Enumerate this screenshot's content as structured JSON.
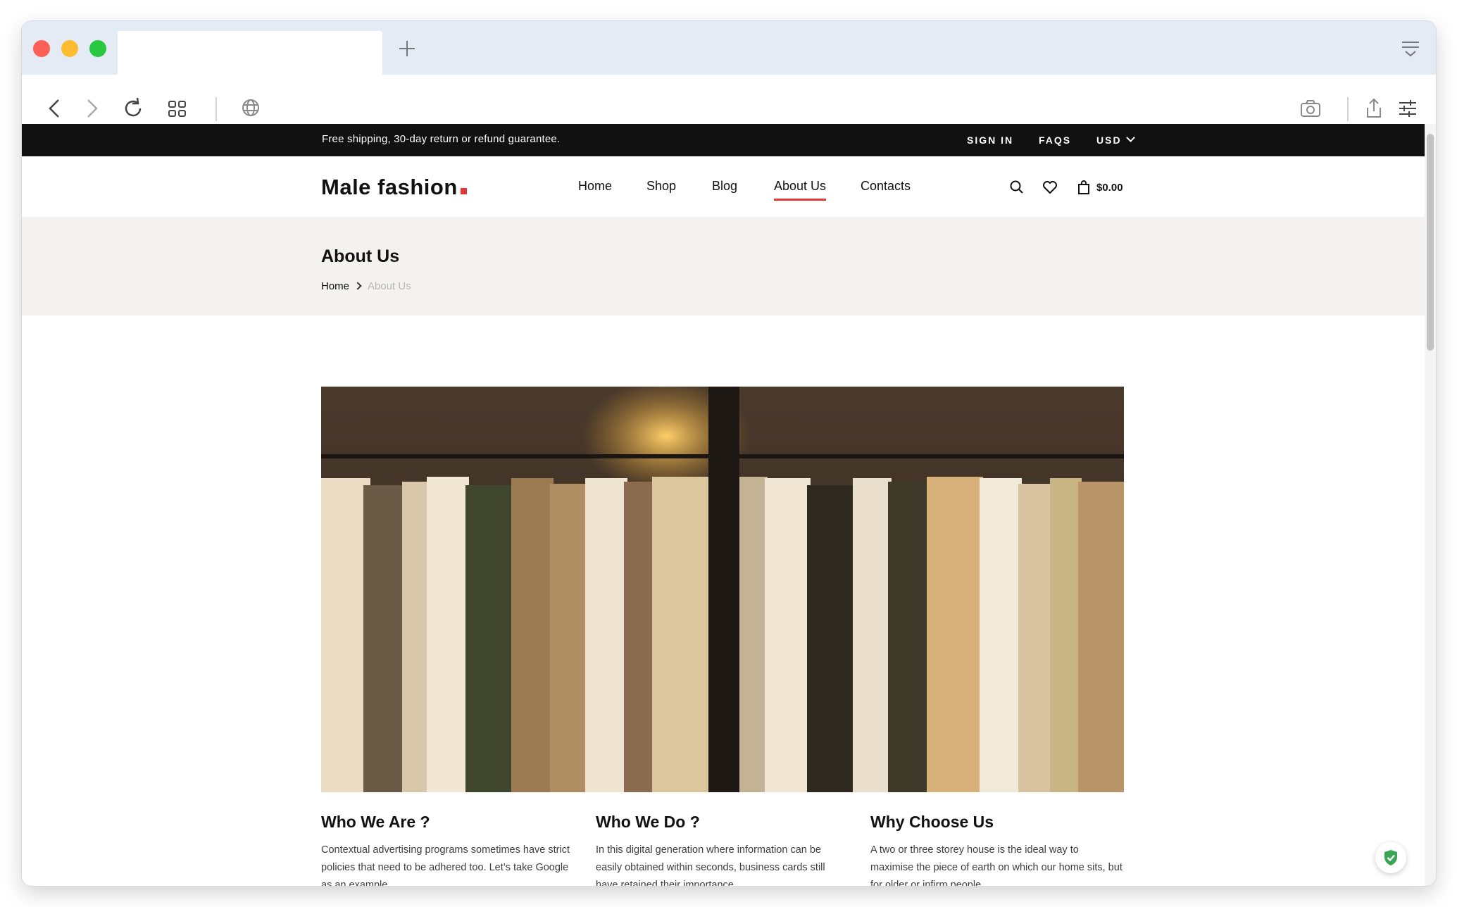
{
  "browser": {
    "new_tab_icon": "plus-icon",
    "tab_menu_icon": "tab-list-icon",
    "toolbar_icons": [
      "back-icon",
      "forward-icon",
      "reload-icon",
      "tabs-grid-icon",
      "globe-icon",
      "camera-icon",
      "share-icon",
      "settings-sliders-icon"
    ]
  },
  "topbar": {
    "shipping_text": "Free shipping, 30-day return or refund guarantee.",
    "sign_in": "SIGN IN",
    "faqs": "FAQS",
    "currency": "USD"
  },
  "header": {
    "logo": "Male fashion",
    "nav": [
      "Home",
      "Shop",
      "Blog",
      "About Us",
      "Contacts"
    ],
    "active_nav": "About Us",
    "cart_total": "$0.00"
  },
  "breadcrumb": {
    "title": "About Us",
    "items": [
      "Home",
      "About Us"
    ]
  },
  "sections": [
    {
      "title": "Who We Are ?",
      "text": "Contextual advertising programs sometimes have strict policies that need to be adhered too. Let’s take Google as an example."
    },
    {
      "title": "Who We Do ?",
      "text": "In this digital generation where information can be easily obtained within seconds, business cards still have retained their importance."
    },
    {
      "title": "Why Choose Us",
      "text": "A two or three storey house is the ideal way to maximise the piece of earth on which our home sits, but for older or infirm people."
    }
  ],
  "colors": {
    "accent": "#e53637",
    "topbar_bg": "#111111",
    "breadcrumb_bg": "#f3f2ee"
  }
}
